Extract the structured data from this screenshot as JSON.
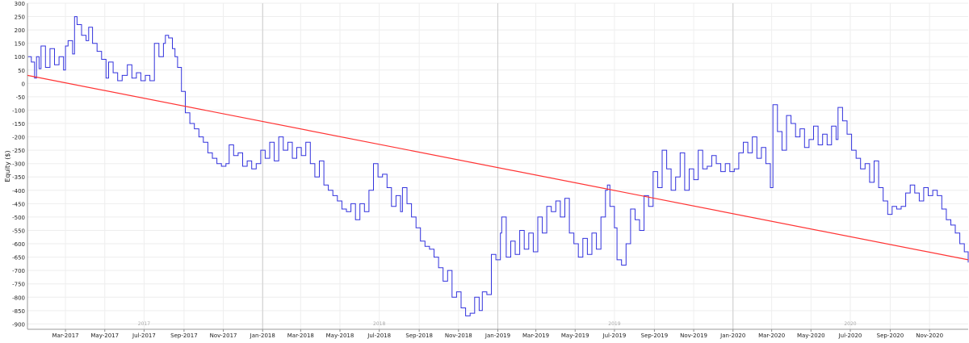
{
  "chart_data": {
    "type": "line",
    "title": "",
    "xlabel": "",
    "ylabel": "Equity ($)",
    "ylim": [
      -920,
      300
    ],
    "y_ticks": [
      300,
      250,
      200,
      150,
      100,
      50,
      0,
      -50,
      -100,
      -150,
      -200,
      -250,
      -300,
      -350,
      -400,
      -450,
      -500,
      -550,
      -600,
      -650,
      -700,
      -750,
      -800,
      -850,
      -900
    ],
    "y_tick_labels": [
      "300",
      "250",
      "200",
      "150",
      "100",
      "50",
      "0",
      "-50",
      "-100",
      "-150",
      "-200",
      "-250",
      "-300",
      "-350",
      "-400",
      "-450",
      "-500",
      "-550",
      "-600",
      "-650",
      "-700",
      "-750",
      "-800",
      "-850",
      "-900"
    ],
    "x_range": [
      "2017-01-01",
      "2020-12-31"
    ],
    "x_ticks": [
      {
        "date": "2017-03-01",
        "label": "Mar-2017"
      },
      {
        "date": "2017-05-01",
        "label": "May-2017"
      },
      {
        "date": "2017-07-01",
        "label": "Jul-2017"
      },
      {
        "date": "2017-09-01",
        "label": "Sep-2017"
      },
      {
        "date": "2017-11-01",
        "label": "Nov-2017"
      },
      {
        "date": "2018-01-01",
        "label": "Jan-2018"
      },
      {
        "date": "2018-03-01",
        "label": "Mar-2018"
      },
      {
        "date": "2018-05-01",
        "label": "May-2018"
      },
      {
        "date": "2018-07-01",
        "label": "Jul-2018"
      },
      {
        "date": "2018-09-01",
        "label": "Sep-2018"
      },
      {
        "date": "2018-11-01",
        "label": "Nov-2018"
      },
      {
        "date": "2019-01-01",
        "label": "Jan-2019"
      },
      {
        "date": "2019-03-01",
        "label": "Mar-2019"
      },
      {
        "date": "2019-05-01",
        "label": "May-2019"
      },
      {
        "date": "2019-07-01",
        "label": "Jul-2019"
      },
      {
        "date": "2019-09-01",
        "label": "Sep-2019"
      },
      {
        "date": "2019-11-01",
        "label": "Nov-2019"
      },
      {
        "date": "2020-01-01",
        "label": "Jan-2020"
      },
      {
        "date": "2020-03-01",
        "label": "Mar-2020"
      },
      {
        "date": "2020-05-01",
        "label": "May-2020"
      },
      {
        "date": "2020-07-01",
        "label": "Jul-2020"
      },
      {
        "date": "2020-09-01",
        "label": "Sep-2020"
      },
      {
        "date": "2020-11-01",
        "label": "Nov-2020"
      }
    ],
    "year_labels": [
      {
        "date": "2017-07-01",
        "label": "2017"
      },
      {
        "date": "2018-07-01",
        "label": "2018"
      },
      {
        "date": "2019-07-01",
        "label": "2019"
      },
      {
        "date": "2020-07-01",
        "label": "2020"
      }
    ],
    "year_separators": [
      "2018-01-01",
      "2019-01-01",
      "2020-01-01"
    ],
    "grid": true,
    "series": [
      {
        "color": "#3333dd",
        "points": [
          [
            "2017-01-02",
            100
          ],
          [
            "2017-01-07",
            80
          ],
          [
            "2017-01-12",
            20
          ],
          [
            "2017-01-15",
            100
          ],
          [
            "2017-01-19",
            55
          ],
          [
            "2017-01-22",
            140
          ],
          [
            "2017-01-29",
            60
          ],
          [
            "2017-02-05",
            130
          ],
          [
            "2017-02-12",
            70
          ],
          [
            "2017-02-19",
            100
          ],
          [
            "2017-02-26",
            50
          ],
          [
            "2017-03-01",
            140
          ],
          [
            "2017-03-05",
            160
          ],
          [
            "2017-03-12",
            110
          ],
          [
            "2017-03-15",
            250
          ],
          [
            "2017-03-19",
            220
          ],
          [
            "2017-03-26",
            180
          ],
          [
            "2017-04-02",
            160
          ],
          [
            "2017-04-06",
            210
          ],
          [
            "2017-04-12",
            150
          ],
          [
            "2017-04-19",
            120
          ],
          [
            "2017-04-26",
            90
          ],
          [
            "2017-05-03",
            20
          ],
          [
            "2017-05-07",
            80
          ],
          [
            "2017-05-14",
            40
          ],
          [
            "2017-05-21",
            10
          ],
          [
            "2017-05-28",
            30
          ],
          [
            "2017-06-05",
            70
          ],
          [
            "2017-06-12",
            20
          ],
          [
            "2017-06-19",
            40
          ],
          [
            "2017-06-26",
            10
          ],
          [
            "2017-07-03",
            30
          ],
          [
            "2017-07-10",
            10
          ],
          [
            "2017-07-17",
            150
          ],
          [
            "2017-07-24",
            100
          ],
          [
            "2017-07-31",
            150
          ],
          [
            "2017-08-03",
            180
          ],
          [
            "2017-08-08",
            170
          ],
          [
            "2017-08-14",
            130
          ],
          [
            "2017-08-18",
            100
          ],
          [
            "2017-08-22",
            60
          ],
          [
            "2017-08-28",
            -30
          ],
          [
            "2017-09-03",
            -110
          ],
          [
            "2017-09-10",
            -150
          ],
          [
            "2017-09-17",
            -170
          ],
          [
            "2017-09-24",
            -200
          ],
          [
            "2017-10-01",
            -220
          ],
          [
            "2017-10-08",
            -260
          ],
          [
            "2017-10-15",
            -280
          ],
          [
            "2017-10-22",
            -300
          ],
          [
            "2017-10-29",
            -310
          ],
          [
            "2017-11-05",
            -300
          ],
          [
            "2017-11-10",
            -230
          ],
          [
            "2017-11-17",
            -270
          ],
          [
            "2017-11-24",
            -260
          ],
          [
            "2017-12-01",
            -310
          ],
          [
            "2017-12-08",
            -290
          ],
          [
            "2017-12-15",
            -320
          ],
          [
            "2017-12-22",
            -300
          ],
          [
            "2017-12-29",
            -250
          ],
          [
            "2018-01-05",
            -280
          ],
          [
            "2018-01-12",
            -220
          ],
          [
            "2018-01-19",
            -290
          ],
          [
            "2018-01-26",
            -200
          ],
          [
            "2018-02-02",
            -250
          ],
          [
            "2018-02-09",
            -220
          ],
          [
            "2018-02-16",
            -280
          ],
          [
            "2018-02-23",
            -240
          ],
          [
            "2018-03-02",
            -270
          ],
          [
            "2018-03-09",
            -220
          ],
          [
            "2018-03-16",
            -300
          ],
          [
            "2018-03-23",
            -350
          ],
          [
            "2018-03-30",
            -290
          ],
          [
            "2018-04-06",
            -380
          ],
          [
            "2018-04-13",
            -400
          ],
          [
            "2018-04-20",
            -420
          ],
          [
            "2018-04-27",
            -440
          ],
          [
            "2018-05-04",
            -470
          ],
          [
            "2018-05-11",
            -480
          ],
          [
            "2018-05-18",
            -450
          ],
          [
            "2018-05-25",
            -510
          ],
          [
            "2018-06-01",
            -450
          ],
          [
            "2018-06-08",
            -480
          ],
          [
            "2018-06-15",
            -400
          ],
          [
            "2018-06-22",
            -300
          ],
          [
            "2018-06-29",
            -350
          ],
          [
            "2018-07-06",
            -340
          ],
          [
            "2018-07-13",
            -390
          ],
          [
            "2018-07-20",
            -460
          ],
          [
            "2018-07-27",
            -420
          ],
          [
            "2018-08-03",
            -480
          ],
          [
            "2018-08-06",
            -390
          ],
          [
            "2018-08-13",
            -450
          ],
          [
            "2018-08-20",
            -500
          ],
          [
            "2018-08-27",
            -540
          ],
          [
            "2018-09-03",
            -590
          ],
          [
            "2018-09-10",
            -610
          ],
          [
            "2018-09-17",
            -620
          ],
          [
            "2018-09-24",
            -650
          ],
          [
            "2018-10-01",
            -690
          ],
          [
            "2018-10-08",
            -740
          ],
          [
            "2018-10-15",
            -700
          ],
          [
            "2018-10-22",
            -800
          ],
          [
            "2018-10-29",
            -780
          ],
          [
            "2018-11-05",
            -840
          ],
          [
            "2018-11-12",
            -870
          ],
          [
            "2018-11-19",
            -860
          ],
          [
            "2018-11-26",
            -800
          ],
          [
            "2018-12-03",
            -850
          ],
          [
            "2018-12-08",
            -780
          ],
          [
            "2018-12-15",
            -790
          ],
          [
            "2018-12-22",
            -640
          ],
          [
            "2018-12-29",
            -660
          ],
          [
            "2019-01-05",
            -560
          ],
          [
            "2019-01-07",
            -500
          ],
          [
            "2019-01-14",
            -650
          ],
          [
            "2019-01-21",
            -590
          ],
          [
            "2019-01-28",
            -640
          ],
          [
            "2019-02-04",
            -550
          ],
          [
            "2019-02-11",
            -620
          ],
          [
            "2019-02-18",
            -560
          ],
          [
            "2019-02-25",
            -630
          ],
          [
            "2019-03-04",
            -500
          ],
          [
            "2019-03-11",
            -560
          ],
          [
            "2019-03-18",
            -460
          ],
          [
            "2019-03-25",
            -480
          ],
          [
            "2019-04-01",
            -440
          ],
          [
            "2019-04-08",
            -500
          ],
          [
            "2019-04-15",
            -430
          ],
          [
            "2019-04-22",
            -560
          ],
          [
            "2019-04-29",
            -600
          ],
          [
            "2019-05-06",
            -650
          ],
          [
            "2019-05-13",
            -580
          ],
          [
            "2019-05-20",
            -640
          ],
          [
            "2019-05-27",
            -560
          ],
          [
            "2019-06-03",
            -620
          ],
          [
            "2019-06-10",
            -500
          ],
          [
            "2019-06-17",
            -400
          ],
          [
            "2019-06-20",
            -380
          ],
          [
            "2019-06-24",
            -460
          ],
          [
            "2019-07-01",
            -540
          ],
          [
            "2019-07-05",
            -660
          ],
          [
            "2019-07-12",
            -680
          ],
          [
            "2019-07-19",
            -600
          ],
          [
            "2019-07-26",
            -470
          ],
          [
            "2019-08-02",
            -510
          ],
          [
            "2019-08-09",
            -550
          ],
          [
            "2019-08-16",
            -420
          ],
          [
            "2019-08-23",
            -460
          ],
          [
            "2019-08-30",
            -330
          ],
          [
            "2019-09-06",
            -390
          ],
          [
            "2019-09-13",
            -250
          ],
          [
            "2019-09-20",
            -320
          ],
          [
            "2019-09-27",
            -400
          ],
          [
            "2019-10-04",
            -350
          ],
          [
            "2019-10-11",
            -260
          ],
          [
            "2019-10-18",
            -400
          ],
          [
            "2019-10-25",
            -320
          ],
          [
            "2019-11-01",
            -360
          ],
          [
            "2019-11-08",
            -250
          ],
          [
            "2019-11-15",
            -320
          ],
          [
            "2019-11-22",
            -310
          ],
          [
            "2019-11-29",
            -270
          ],
          [
            "2019-12-06",
            -300
          ],
          [
            "2019-12-13",
            -330
          ],
          [
            "2019-12-20",
            -300
          ],
          [
            "2019-12-27",
            -330
          ],
          [
            "2020-01-03",
            -320
          ],
          [
            "2020-01-10",
            -260
          ],
          [
            "2020-01-17",
            -220
          ],
          [
            "2020-01-24",
            -260
          ],
          [
            "2020-01-31",
            -200
          ],
          [
            "2020-02-07",
            -280
          ],
          [
            "2020-02-14",
            -240
          ],
          [
            "2020-02-21",
            -300
          ],
          [
            "2020-02-28",
            -390
          ],
          [
            "2020-03-03",
            -80
          ],
          [
            "2020-03-10",
            -180
          ],
          [
            "2020-03-17",
            -250
          ],
          [
            "2020-03-24",
            -120
          ],
          [
            "2020-03-31",
            -150
          ],
          [
            "2020-04-07",
            -200
          ],
          [
            "2020-04-14",
            -170
          ],
          [
            "2020-04-21",
            -240
          ],
          [
            "2020-04-28",
            -210
          ],
          [
            "2020-05-05",
            -160
          ],
          [
            "2020-05-12",
            -230
          ],
          [
            "2020-05-19",
            -190
          ],
          [
            "2020-05-26",
            -230
          ],
          [
            "2020-06-02",
            -160
          ],
          [
            "2020-06-09",
            -210
          ],
          [
            "2020-06-12",
            -90
          ],
          [
            "2020-06-19",
            -140
          ],
          [
            "2020-06-26",
            -190
          ],
          [
            "2020-07-03",
            -250
          ],
          [
            "2020-07-10",
            -280
          ],
          [
            "2020-07-17",
            -320
          ],
          [
            "2020-07-24",
            -300
          ],
          [
            "2020-07-31",
            -370
          ],
          [
            "2020-08-07",
            -290
          ],
          [
            "2020-08-14",
            -390
          ],
          [
            "2020-08-21",
            -440
          ],
          [
            "2020-08-28",
            -490
          ],
          [
            "2020-09-04",
            -460
          ],
          [
            "2020-09-11",
            -470
          ],
          [
            "2020-09-18",
            -460
          ],
          [
            "2020-09-25",
            -410
          ],
          [
            "2020-10-02",
            -380
          ],
          [
            "2020-10-09",
            -410
          ],
          [
            "2020-10-16",
            -440
          ],
          [
            "2020-10-23",
            -390
          ],
          [
            "2020-10-30",
            -420
          ],
          [
            "2020-11-06",
            -400
          ],
          [
            "2020-11-13",
            -420
          ],
          [
            "2020-11-20",
            -470
          ],
          [
            "2020-11-27",
            -510
          ],
          [
            "2020-12-04",
            -530
          ],
          [
            "2020-12-11",
            -560
          ],
          [
            "2020-12-18",
            -600
          ],
          [
            "2020-12-25",
            -630
          ],
          [
            "2020-12-31",
            -670
          ]
        ]
      },
      {
        "color": "#ff3333",
        "points": [
          [
            "2017-01-01",
            30
          ],
          [
            "2020-12-31",
            -660
          ]
        ]
      }
    ]
  }
}
